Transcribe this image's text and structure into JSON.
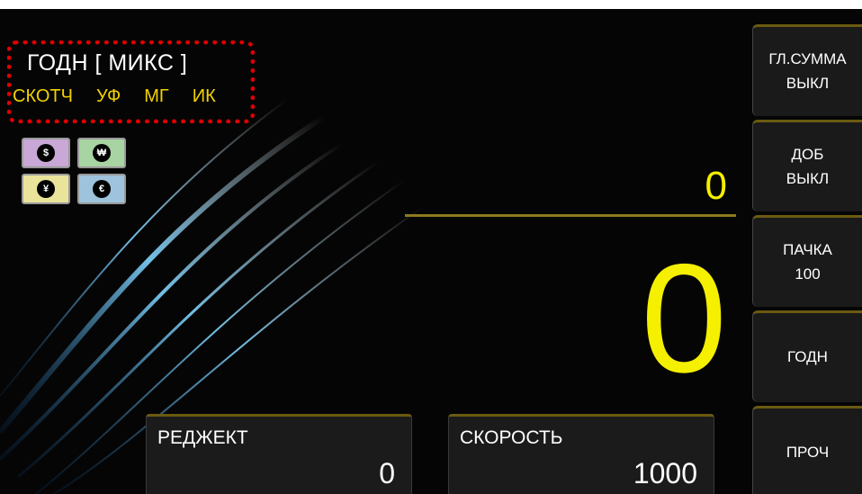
{
  "mode": {
    "title": "ГОДН [ МИКС ]",
    "flags": [
      "СКОТЧ",
      "УФ",
      "МГ",
      "ИК"
    ]
  },
  "currencies": [
    {
      "symbol": "$",
      "icon": "dollar-icon",
      "color": "#c9a7d6"
    },
    {
      "symbol": "₩",
      "icon": "won-icon",
      "color": "#a8d3a2"
    },
    {
      "symbol": "¥",
      "icon": "yen-icon",
      "color": "#e9e49a"
    },
    {
      "symbol": "€",
      "icon": "euro-icon",
      "color": "#9dc3dd"
    }
  ],
  "counters": {
    "total": "0",
    "current": "0"
  },
  "panels": {
    "reject": {
      "label": "РЕДЖЕКТ",
      "value": "0"
    },
    "speed": {
      "label": "СКОРОСТЬ",
      "value": "1000"
    }
  },
  "sidebar": [
    {
      "line1": "ГЛ.СУММА",
      "line2": "ВЫКЛ"
    },
    {
      "line1": "ДОБ",
      "line2": "ВЫКЛ"
    },
    {
      "line1": "ПАЧКА",
      "line2": "100"
    },
    {
      "line1": "ГОДН",
      "line2": ""
    },
    {
      "line1": "ПРОЧ",
      "line2": ""
    }
  ],
  "colors": {
    "accent": "#f5ef00",
    "mode_border": "#e00000",
    "flags": "#f2d200"
  }
}
